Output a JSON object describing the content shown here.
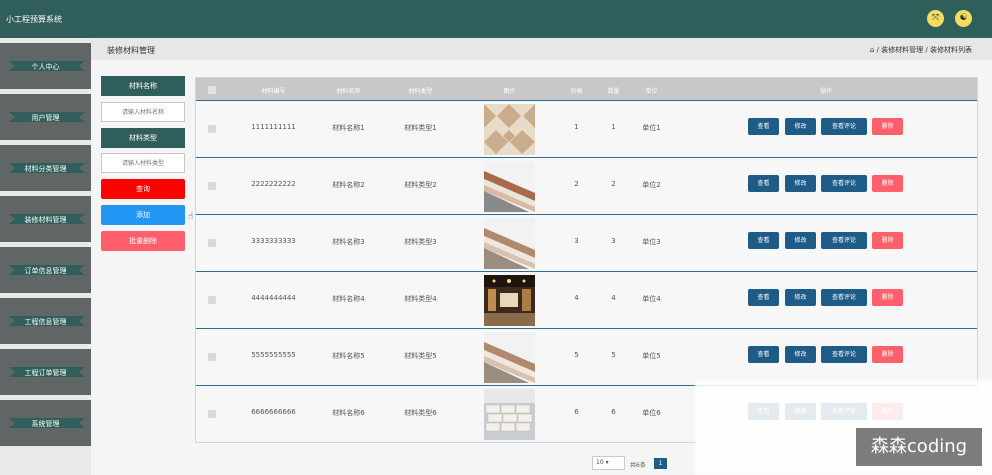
{
  "app": {
    "title": "小工程预算系统",
    "icon_left": "settings-icon",
    "icon_right": "user-icon"
  },
  "sidebar": {
    "items": [
      {
        "label": "个人中心"
      },
      {
        "label": "用户管理"
      },
      {
        "label": "材料分类管理"
      },
      {
        "label": "装修材料管理"
      },
      {
        "label": "订单信息管理"
      },
      {
        "label": "工程信息管理"
      },
      {
        "label": "工程订单管理"
      },
      {
        "label": "系统管理"
      }
    ]
  },
  "page": {
    "title": "装修材料管理",
    "breadcrumb": "/ 装修材料管理 / 装修材料列表"
  },
  "filters": {
    "name_label": "材料名称",
    "name_placeholder": "请输入材料名称",
    "type_label": "材料类型",
    "type_placeholder": "请输入材料类型",
    "search": "查询",
    "add": "添加",
    "batch_delete": "批量删除"
  },
  "table": {
    "headers": [
      "材料编号",
      "材料名称",
      "材料类型",
      "图片",
      "价格",
      "数量",
      "单位",
      "操作"
    ],
    "rows": [
      {
        "id": "1111111111",
        "name": "材料名称1",
        "type": "材料类型1",
        "price": "1",
        "qty": "1",
        "unit": "单位1"
      },
      {
        "id": "2222222222",
        "name": "材料名称2",
        "type": "材料类型2",
        "price": "2",
        "qty": "2",
        "unit": "单位2"
      },
      {
        "id": "3333333333",
        "name": "材料名称3",
        "type": "材料类型3",
        "price": "3",
        "qty": "3",
        "unit": "单位3"
      },
      {
        "id": "4444444444",
        "name": "材料名称4",
        "type": "材料类型4",
        "price": "4",
        "qty": "4",
        "unit": "单位4"
      },
      {
        "id": "5555555555",
        "name": "材料名称5",
        "type": "材料类型5",
        "price": "5",
        "qty": "5",
        "unit": "单位5"
      },
      {
        "id": "6666666666",
        "name": "材料名称6",
        "type": "材料类型6",
        "price": "6",
        "qty": "6",
        "unit": "单位6"
      }
    ],
    "actions": {
      "view": "查看",
      "edit": "修改",
      "comments": "查看评论",
      "delete": "删除"
    }
  },
  "pagination": {
    "page_size": "10",
    "total": "共6条",
    "current": "1"
  },
  "watermark": "森森coding",
  "colors": {
    "brand": "#305e5a",
    "sidebar_dark": "#5f6665",
    "search": "#ff0000",
    "add": "#2196f3",
    "batch_delete": "#ff5f6a",
    "action": "#1e5b87",
    "delete": "#ff5f6a"
  }
}
